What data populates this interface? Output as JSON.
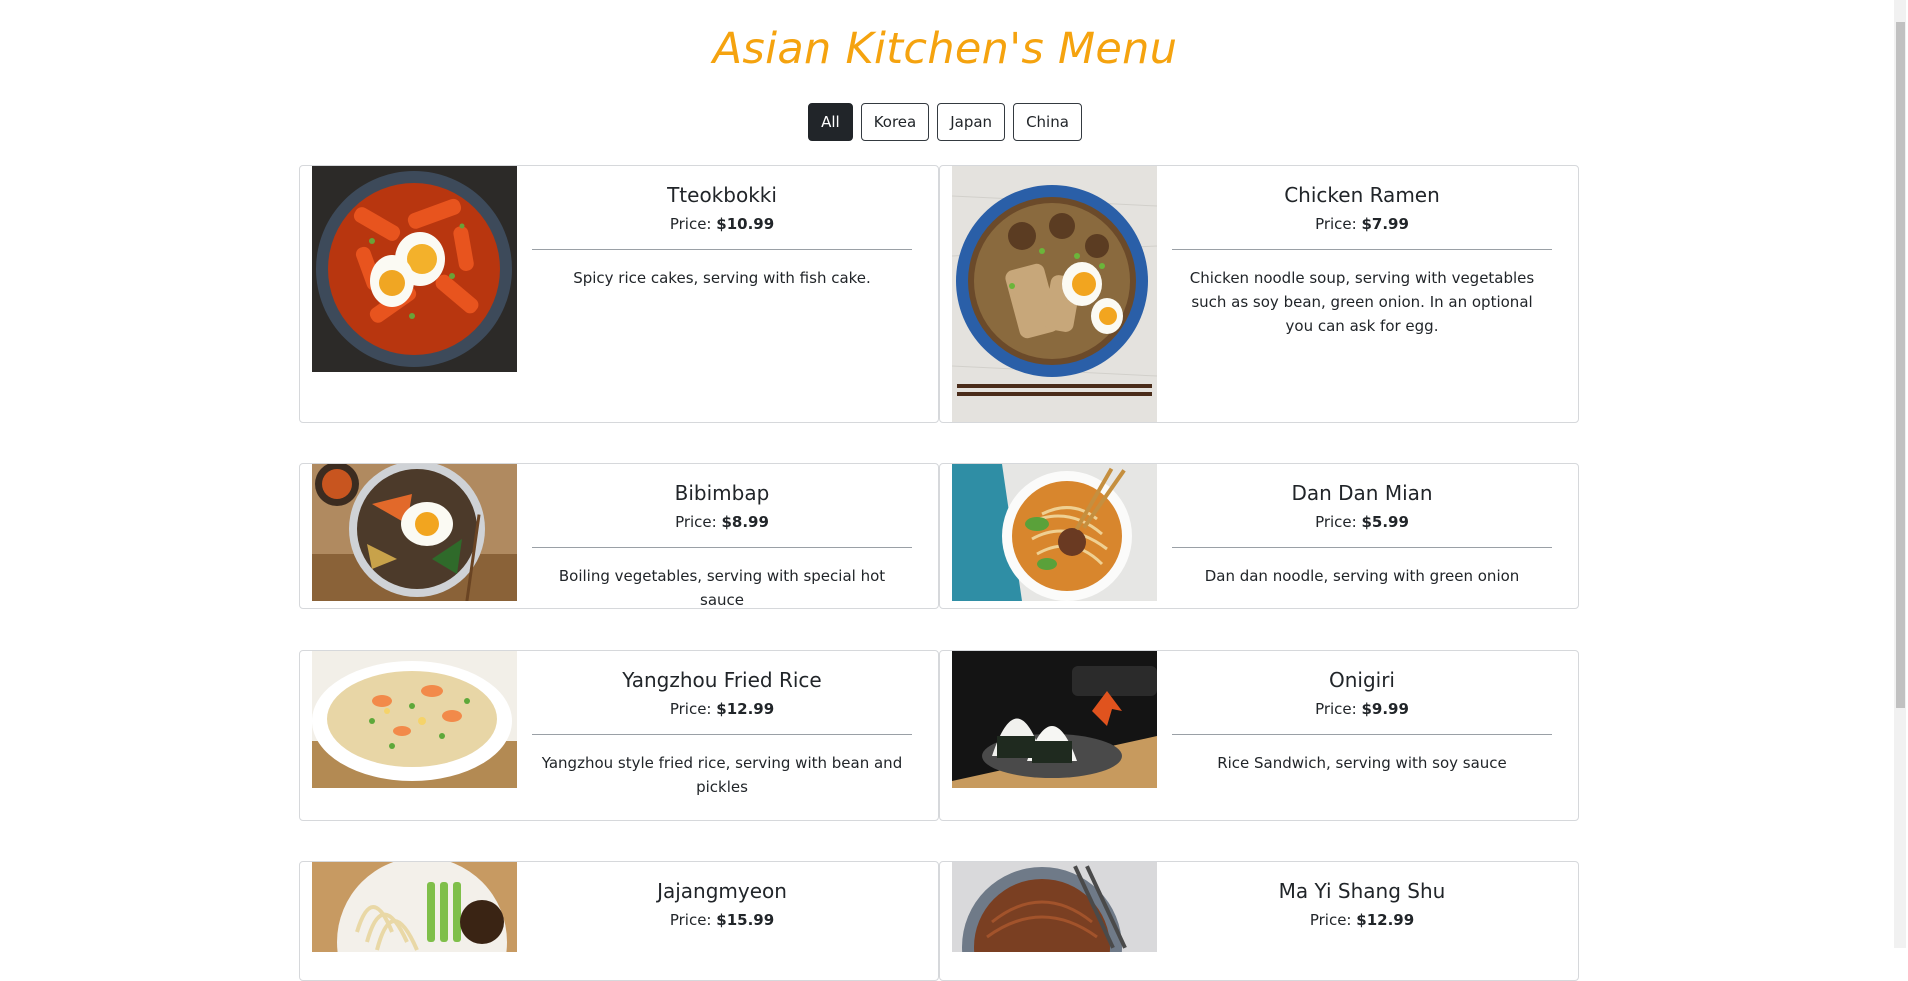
{
  "header": {
    "title": "Asian Kitchen's Menu"
  },
  "filters": [
    {
      "label": "All",
      "active": true
    },
    {
      "label": "Korea",
      "active": false
    },
    {
      "label": "Japan",
      "active": false
    },
    {
      "label": "China",
      "active": false
    }
  ],
  "price_prefix": "Price: ",
  "dishes": [
    {
      "name": "Tteokbokki",
      "price": "$10.99",
      "desc": "Spicy rice cakes, serving with fish cake.",
      "image": "tteokbokki-photo"
    },
    {
      "name": "Chicken Ramen",
      "price": "$7.99",
      "desc": "Chicken noodle soup, serving with vegetables such as soy bean, green onion. In an optional you can ask for egg.",
      "image": "chicken-ramen-photo"
    },
    {
      "name": "Bibimbap",
      "price": "$8.99",
      "desc": "Boiling vegetables, serving with special hot sauce",
      "image": "bibimbap-photo"
    },
    {
      "name": "Dan Dan Mian",
      "price": "$5.99",
      "desc": "Dan dan noodle, serving with green onion",
      "image": "dan-dan-mian-photo"
    },
    {
      "name": "Yangzhou Fried Rice",
      "price": "$12.99",
      "desc": "Yangzhou style fried rice, serving with bean and pickles",
      "image": "fried-rice-photo"
    },
    {
      "name": "Onigiri",
      "price": "$9.99",
      "desc": "Rice Sandwich, serving with soy sauce",
      "image": "onigiri-photo"
    },
    {
      "name": "Jajangmyeon",
      "price": "$15.99",
      "desc": "",
      "image": "jajangmyeon-photo"
    },
    {
      "name": "Ma Yi Shang Shu",
      "price": "$12.99",
      "desc": "",
      "image": "ma-yi-shang-shu-photo"
    }
  ],
  "colors": {
    "title": "#f5a30f",
    "active_filter": "#212529",
    "card_border": "#d6d8db"
  }
}
